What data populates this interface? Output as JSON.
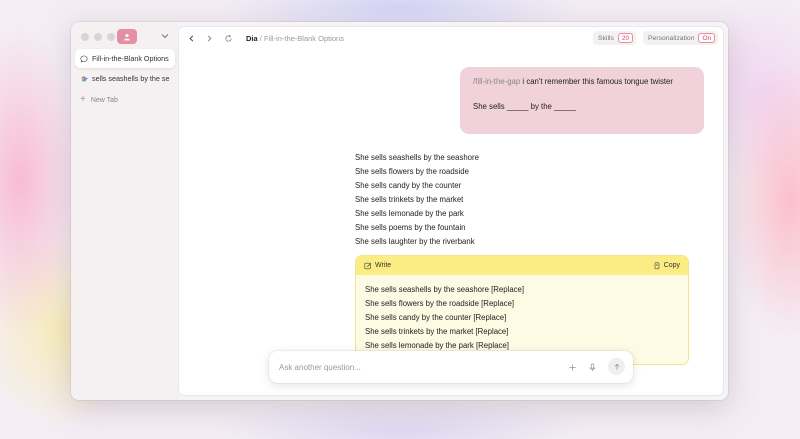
{
  "sidebar": {
    "tabs": [
      {
        "label": "Fill-in-the-Blank Options",
        "icon": "chat-icon",
        "active": true
      },
      {
        "label": "sells seashells by the se",
        "icon": "google-icon",
        "active": false
      }
    ],
    "new_tab_label": "New Tab"
  },
  "toolbar": {
    "app_name": "Dia",
    "separator": "/",
    "page_title": "Fill-in-the-Blank Options",
    "skills_label": "Skills",
    "skills_count": "20",
    "personalization_label": "Personalization",
    "personalization_state": "On"
  },
  "prompt": {
    "command": "/fill-in-the-gap",
    "text": " i can't remember this famous tongue twister",
    "line2": "She sells _____ by the _____"
  },
  "response": {
    "lines": [
      "She sells seashells by the seashore",
      "She sells flowers by the roadside",
      "She sells candy by the counter",
      "She sells trinkets by the market",
      "She sells lemonade by the park",
      "She sells poems by the fountain",
      "She sells laughter by the riverbank"
    ]
  },
  "write_card": {
    "title": "Write",
    "copy_label": "Copy",
    "lines": [
      "She sells seashells by the seashore [Replace]",
      "She sells flowers by the roadside [Replace]",
      "She sells candy by the counter [Replace]",
      "She sells trinkets by the market [Replace]",
      "She sells lemonade by the park [Replace]"
    ]
  },
  "ask": {
    "placeholder": "Ask another question...",
    "value": ""
  },
  "colors": {
    "accent": "#e58fa4",
    "prompt_bubble": "#f1d2da",
    "write_header": "#fbec84",
    "badge_text": "#d2465f"
  }
}
